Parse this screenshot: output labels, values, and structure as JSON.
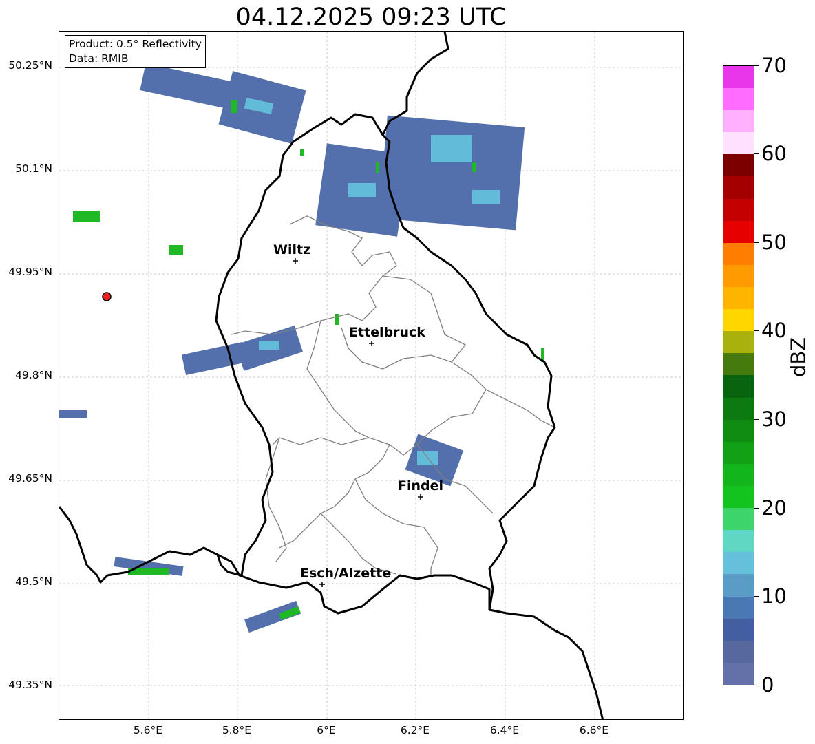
{
  "title": "04.12.2025 09:23 UTC",
  "info": {
    "line1": "Product: 0.5° Reflectivity",
    "line2": "Data: RMIB"
  },
  "axes": {
    "lat_ticks": [
      "50.25°N",
      "50.1°N",
      "49.95°N",
      "49.8°N",
      "49.65°N",
      "49.5°N",
      "49.35°N"
    ],
    "lon_ticks": [
      "5.6°E",
      "5.8°E",
      "6°E",
      "6.2°E",
      "6.4°E",
      "6.6°E"
    ]
  },
  "cities": [
    {
      "name": "Wiltz",
      "lon": 5.93,
      "lat": 49.97
    },
    {
      "name": "Ettelbruck",
      "lon": 6.1,
      "lat": 49.85
    },
    {
      "name": "Findel",
      "lon": 6.21,
      "lat": 49.63
    },
    {
      "name": "Esch/Alzette",
      "lon": 5.99,
      "lat": 49.5
    }
  ],
  "radar_site": {
    "lon": 5.51,
    "lat": 49.915,
    "color": "#e8231e"
  },
  "colorbar": {
    "label": "dBZ",
    "min": 0,
    "max": 70,
    "tick_labels": [
      "0",
      "10",
      "20",
      "30",
      "40",
      "50",
      "60",
      "70"
    ],
    "colors": [
      "#6470a8",
      "#56689e",
      "#445ea2",
      "#4a78b2",
      "#5b9cc6",
      "#66c0dc",
      "#5fd8c3",
      "#3ed46c",
      "#12c41d",
      "#12b61a",
      "#12a016",
      "#108c12",
      "#0c7a10",
      "#08640e",
      "#457a0e",
      "#a9b20c",
      "#ffd600",
      "#ffb400",
      "#ff9a00",
      "#ff7e00",
      "#e60000",
      "#c40000",
      "#a40000",
      "#7c0000",
      "#ffe0ff",
      "#ffb0ff",
      "#ff6cff",
      "#ea36ea"
    ]
  },
  "map_extent": {
    "lon_min": 5.4,
    "lon_max": 6.8,
    "lat_min": 49.32,
    "lat_max": 50.3
  },
  "grid": true
}
